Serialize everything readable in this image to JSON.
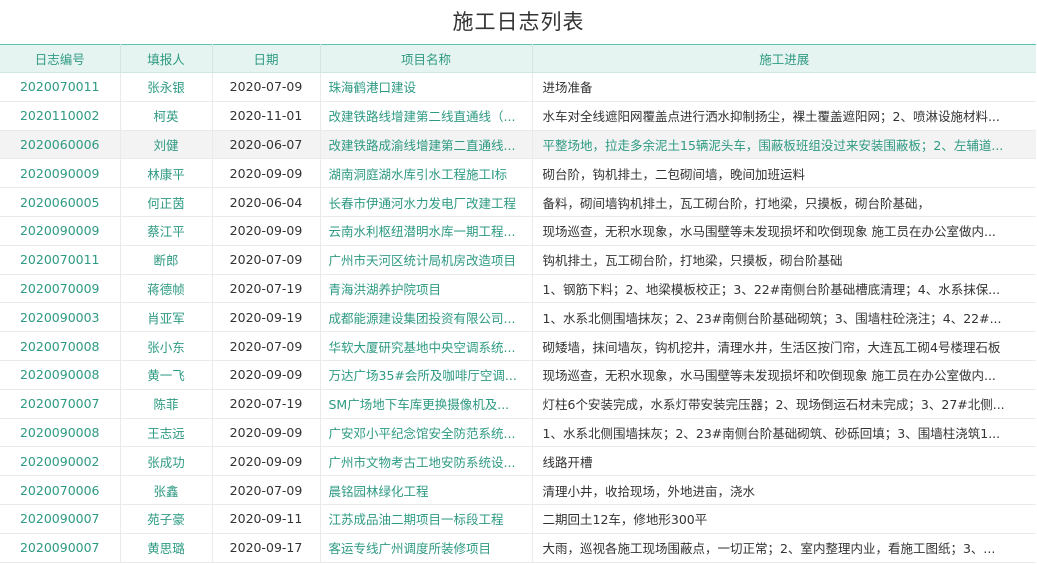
{
  "title": "施工日志列表",
  "columns": [
    "日志编号",
    "填报人",
    "日期",
    "项目名称",
    "施工进展"
  ],
  "rows": [
    {
      "id": "2020070011",
      "reporter": "张永银",
      "date": "2020-07-09",
      "project": "珠海鹤港口建设",
      "progress": "进场准备"
    },
    {
      "id": "2020110002",
      "reporter": "柯英",
      "date": "2020-11-01",
      "project": "改建铁路线增建第二线直通线（...",
      "progress": "水车对全线遮阳网覆盖点进行洒水抑制扬尘，裸土覆盖遮阳网；2、喷淋设施材料..."
    },
    {
      "id": "2020060006",
      "reporter": "刘健",
      "date": "2020-06-07",
      "project": "改建铁路成渝线增建第二直通线...",
      "progress": "平整场地，拉走多余泥土15辆泥头车，围蔽板班组没过来安装围蔽板；2、左辅道..."
    },
    {
      "id": "2020090009",
      "reporter": "林康平",
      "date": "2020-09-09",
      "project": "湖南洞庭湖水库引水工程施工I标",
      "progress": "砌台阶，钩机排土，二包砌间墙，晚间加班运料"
    },
    {
      "id": "2020060005",
      "reporter": "何正茵",
      "date": "2020-06-04",
      "project": "长春市伊通河水力发电厂改建工程",
      "progress": "备料，砌间墙钩机排土，瓦工砌台阶，打地梁，只摸板，砌台阶基础，"
    },
    {
      "id": "2020090009",
      "reporter": "蔡江平",
      "date": "2020-09-09",
      "project": "云南水利枢纽潜明水库一期工程...",
      "progress": "现场巡查，无积水现象，水马围壁等未发现损坏和吹倒现象 施工员在办公室做内..."
    },
    {
      "id": "2020070011",
      "reporter": "断郎",
      "date": "2020-07-09",
      "project": "广州市天河区统计局机房改造项目",
      "progress": "钩机排土，瓦工砌台阶，打地梁，只摸板，砌台阶基础"
    },
    {
      "id": "2020070009",
      "reporter": "蒋德帧",
      "date": "2020-07-19",
      "project": "青海洪湖养护院项目",
      "progress": "1、钢筋下料；2、地梁模板校正；3、22#南侧台阶基础槽底清理；4、水系抹保..."
    },
    {
      "id": "2020090003",
      "reporter": "肖亚军",
      "date": "2020-09-19",
      "project": "成都能源建设集团投资有限公司...",
      "progress": "1、水系北侧围墙抹灰；2、23#南侧台阶基础砌筑；3、围墙柱砼浇注；4、22#..."
    },
    {
      "id": "2020070008",
      "reporter": "张小东",
      "date": "2020-07-09",
      "project": "华软大厦研究基地中央空调系统...",
      "progress": "砌矮墙，抹间墙灰，钩机挖井，清理水井，生活区按门帘，大连瓦工砌4号楼理石板"
    },
    {
      "id": "2020090008",
      "reporter": "黄一飞",
      "date": "2020-09-09",
      "project": "万达广场35#会所及咖啡厅空调...",
      "progress": "现场巡查，无积水现象，水马围壁等未发现损坏和吹倒现象 施工员在办公室做内..."
    },
    {
      "id": "2020070007",
      "reporter": "陈菲",
      "date": "2020-07-19",
      "project": "SM广场地下车库更换摄像机及...",
      "progress": "灯柱6个安装完成，水系灯带安装完压器；2、现场倒运石材未完成；3、27#北侧..."
    },
    {
      "id": "2020090008",
      "reporter": "王志远",
      "date": "2020-09-09",
      "project": "广安邓小平纪念馆安全防范系统...",
      "progress": "1、水系北侧围墙抹灰；2、23#南侧台阶基础砌筑、砂砾回填；3、围墙柱浇筑1..."
    },
    {
      "id": "2020090002",
      "reporter": "张成功",
      "date": "2020-09-09",
      "project": "广州市文物考古工地安防系统设...",
      "progress": "线路开槽"
    },
    {
      "id": "2020070006",
      "reporter": "张鑫",
      "date": "2020-07-09",
      "project": "晨铭园林绿化工程",
      "progress": "清理小井，收拾现场，外地进亩，浇水"
    },
    {
      "id": "2020090007",
      "reporter": "苑子豪",
      "date": "2020-09-11",
      "project": "江苏成品油二期项目一标段工程",
      "progress": "二期回土12车，修地形300平"
    },
    {
      "id": "2020090007",
      "reporter": "黄思璐",
      "date": "2020-09-17",
      "project": "客运专线广州调度所装修项目",
      "progress": "大雨，巡视各施工现场围蔽点，一切正常；2、室内整理内业，看施工图纸；3、..."
    }
  ],
  "selected_row": 2
}
